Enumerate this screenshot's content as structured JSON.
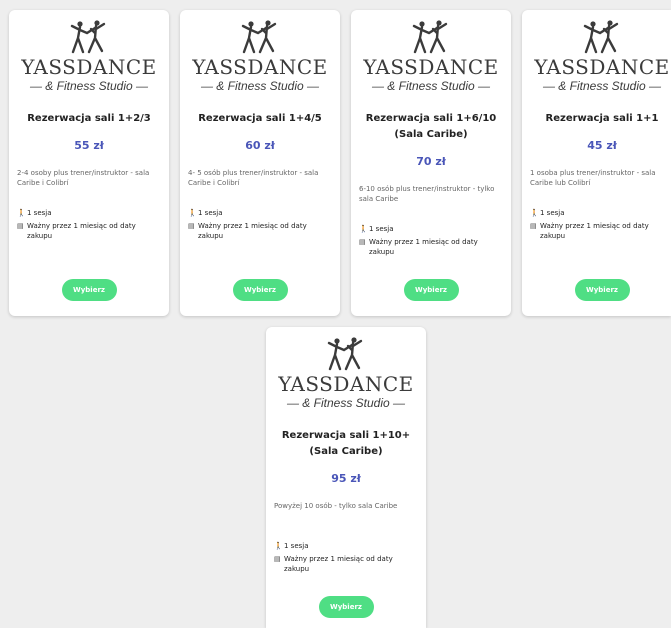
{
  "brand": {
    "name": "YASSDANCE",
    "subtitle": "— & Fitness Studio —"
  },
  "cards": [
    {
      "title": "Rezerwacja sali 1+2/3",
      "price": "55 zł",
      "desc": "2-4 osoby plus trener/instruktor - sala Caribe i Colibrí",
      "sessions": "1 sesja",
      "validity": "Ważny przez 1 miesiąc od daty zakupu",
      "button": "Wybierz"
    },
    {
      "title": "Rezerwacja sali 1+4/5",
      "price": "60 zł",
      "desc": "4- 5 osób plus trener/instruktor - sala Caribe i Colibrí",
      "sessions": "1 sesja",
      "validity": "Ważny przez 1 miesiąc od daty zakupu",
      "button": "Wybierz"
    },
    {
      "title": "Rezerwacja sali 1+6/10 (Sala Caribe)",
      "price": "70 zł",
      "desc": "6-10 osób plus trener/instruktor - tylko sala Caribe",
      "sessions": "1 sesja",
      "validity": "Ważny przez 1 miesiąc od daty zakupu",
      "button": "Wybierz"
    },
    {
      "title": "Rezerwacja sali 1+1",
      "price": "45 zł",
      "desc": "1 osoba plus trener/instruktor - sala Caribe lub Colibrí",
      "sessions": "1 sesja",
      "validity": "Ważny przez 1 miesiąc od daty zakupu",
      "button": "Wybierz"
    },
    {
      "title": "Rezerwacja sali 1+10+ (Sala Caribe)",
      "price": "95 zł",
      "desc": "Powyżej 10 osób - tylko sala Caribe",
      "sessions": "1 sesja",
      "validity": "Ważny przez 1 miesiąc od daty zakupu",
      "button": "Wybierz"
    }
  ],
  "icons": {
    "sessions": "walking-person-icon",
    "validity": "calendar-icon"
  },
  "colors": {
    "price": "#4a56b8",
    "button": "#4fde84",
    "background": "#eeeeee"
  }
}
